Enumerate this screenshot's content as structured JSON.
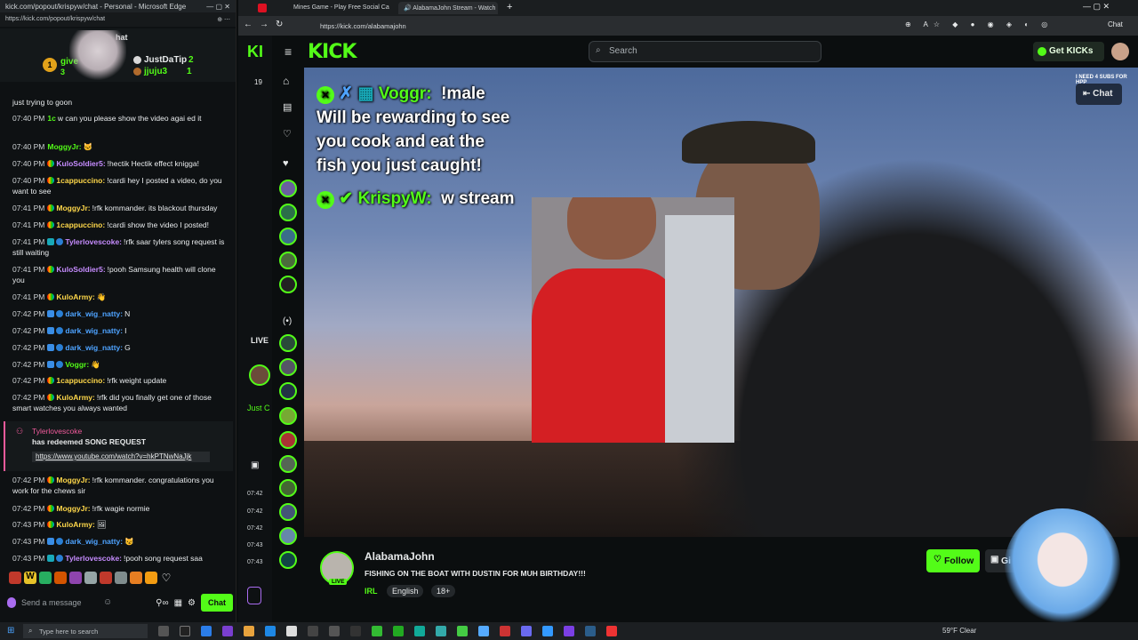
{
  "left_window": {
    "title": "kick.com/popout/krispyw/chat - Personal - Microsoft Edge",
    "url": "https://kick.com/popout/krispyw/chat",
    "gifts": {
      "header_fragment": "hat",
      "left_user": "give",
      "left_count": "3",
      "users": [
        {
          "name": "JustDaTip",
          "count": "2"
        },
        {
          "name": "jjuju3",
          "count": "1"
        }
      ]
    },
    "messages": [
      {
        "time": "",
        "user": "",
        "text": "just trying to goon",
        "top": 0
      },
      {
        "time": "07:40 PM",
        "user": "1c",
        "text": "w can you please show the video agai     ed it"
      },
      {
        "time": "07:40 PM",
        "user": "MoggyJr:",
        "text": ""
      },
      {
        "time": "07:40 PM",
        "user": "KuloSoldier5:",
        "text": "!hectik Hectik effect knigga!"
      },
      {
        "time": "07:40 PM",
        "user": "1cappuccino:",
        "text": "!cardi hey I posted a video, do you want to see"
      },
      {
        "time": "07:41 PM",
        "user": "MoggyJr:",
        "text": "!rfk kommander. its blackout thursday"
      },
      {
        "time": "07:41 PM",
        "user": "1cappuccino:",
        "text": "!cardi show the video I posted!"
      },
      {
        "time": "07:41 PM",
        "user": "Tylerlovescoke:",
        "text": "!rfk saar tylers song request is still waiting"
      },
      {
        "time": "07:41 PM",
        "user": "KuloSoldier5:",
        "text": "!pooh Samsung health will clone you"
      },
      {
        "time": "07:41 PM",
        "user": "KuloArmy:",
        "text": ""
      },
      {
        "time": "07:42 PM",
        "user": "dark_wig_natty:",
        "text": "N"
      },
      {
        "time": "07:42 PM",
        "user": "dark_wig_natty:",
        "text": "I"
      },
      {
        "time": "07:42 PM",
        "user": "dark_wig_natty:",
        "text": "G"
      },
      {
        "time": "07:42 PM",
        "user": "Voggr:",
        "text": ""
      },
      {
        "time": "07:42 PM",
        "user": "1cappuccino:",
        "text": "!rfk weight update"
      },
      {
        "time": "07:42 PM",
        "user": "KuloArmy:",
        "text": "!rfk did you finally get one of those smart watches you always wanted"
      }
    ],
    "song_request": {
      "user": "Tylerlovescoke",
      "text": "has redeemed SONG REQUEST",
      "link": "https://www.youtube.com/watch?v=hkPTNwNaJjk"
    },
    "messages_after": [
      {
        "time": "07:42 PM",
        "user": "MoggyJr:",
        "text": "!rfk kommander. congratulations you work for the chews sir"
      },
      {
        "time": "07:42 PM",
        "user": "MoggyJr:",
        "text": "!rfk wagie normie"
      },
      {
        "time": "07:43 PM",
        "user": "KuloArmy:",
        "text": ""
      },
      {
        "time": "07:43 PM",
        "user": "dark_wig_natty:",
        "text": ""
      },
      {
        "time": "07:43 PM",
        "user": "Tylerlovescoke:",
        "text": "!pooh song request saa"
      }
    ],
    "input_placeholder": "Send a message",
    "chat_button": "Chat"
  },
  "right_window": {
    "tabs": [
      {
        "label": "Mines Game - Play Free Social Ca"
      },
      {
        "label": "AlabamaJohn Stream - Watch"
      }
    ],
    "url": "https://kick.com/alabamajohn",
    "search_placeholder": "Search",
    "get_kicks": "Get KICKs",
    "brand": "KICK",
    "video_overlay": {
      "line1_user": "Voggr:",
      "line1_text": "!male",
      "body": [
        "Will be rewarding to see",
        "you cook and eat the",
        "fish you just caught!"
      ],
      "line2_user": "KrispyW:",
      "line2_text": "w stream"
    },
    "chat_toggle": "Chat",
    "top_right_banner": "I NEED 4 SUBS FOR HPP",
    "streamer": {
      "name": "AlabamaJohn",
      "title": "FISHING ON THE BOAT WITH DUSTIN FOR MUH BIRTHDAY!!!",
      "category": "IRL",
      "tags": [
        "English",
        "18+"
      ],
      "live_badge": "LIVE"
    },
    "follow_button": "Follow",
    "gift_button": "Gi",
    "side_live_label": "LIVE",
    "side_just": "Just C",
    "side_count": "19",
    "side_times": [
      "07:42",
      "07:42",
      "07:42",
      "07:43",
      "07:43"
    ]
  },
  "taskbar": {
    "search_placeholder": "Type here to search",
    "weather": "59°F Clear"
  },
  "colors": {
    "kick_green": "#53fc18",
    "background": "#0b0e0f"
  }
}
